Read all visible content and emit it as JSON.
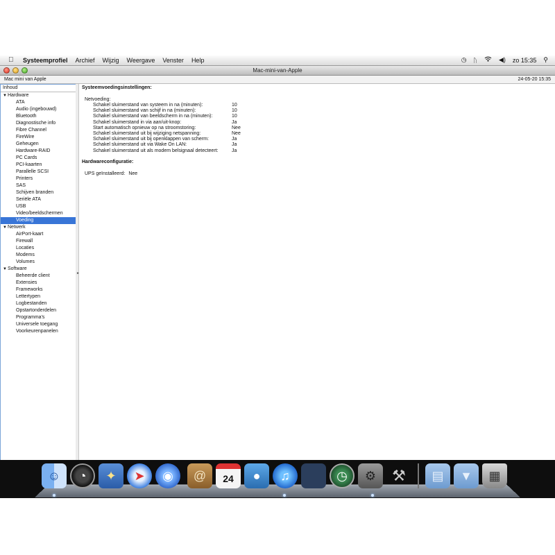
{
  "menubar": {
    "app": "Systeemprofiel",
    "items": [
      "Archief",
      "Wijzig",
      "Weergave",
      "Venster",
      "Help"
    ],
    "clock": "zo 15:35"
  },
  "window": {
    "title": "Mac-mini-van-Apple",
    "machine_label": "Mac mini  van Apple",
    "date": "24-05-20 15:35"
  },
  "sidebar": {
    "header": "Inhoud",
    "categories": [
      {
        "label": "Hardware",
        "items": [
          "ATA",
          "Audio (ingebouwd)",
          "Bluetooth",
          "Diagnostische info",
          "Fibre Channel",
          "FireWire",
          "Geheugen",
          "Hardware-RAID",
          "PC Cards",
          "PCI-kaarten",
          "Parallelle SCSI",
          "Printers",
          "SAS",
          "Schijven branden",
          "Seriële ATA",
          "USB",
          "Video/beeldschermen",
          "Voeding"
        ]
      },
      {
        "label": "Netwerk",
        "items": [
          "AirPort-kaart",
          "Firewall",
          "Locaties",
          "Modems",
          "Volumes"
        ]
      },
      {
        "label": "Software",
        "items": [
          "Beheerde client",
          "Extensies",
          "Frameworks",
          "Lettertypen",
          "Logbestanden",
          "Opstartonderdelen",
          "Programma's",
          "Universele toegang",
          "Voorkeurenpanelen"
        ]
      }
    ],
    "selected": "Voeding"
  },
  "content": {
    "section1": "Systeemvoedingsinstellingen:",
    "sub1": "Netvoeding:",
    "settings": [
      {
        "key": "Schakel sluimerstand van systeem in na (minuten):",
        "value": "10"
      },
      {
        "key": "Schakel sluimerstand van schijf in na (minuten):",
        "value": "10"
      },
      {
        "key": "Schakel sluimerstand van beeldscherm in na (minuten):",
        "value": "10"
      },
      {
        "key": "Schakel sluimerstand in via aan/uit-knop:",
        "value": "Ja"
      },
      {
        "key": "Start automatisch opnieuw op na stroomstoring:",
        "value": "Nee"
      },
      {
        "key": "Schakel sluimerstand uit bij wijziging netspanning:",
        "value": "Nee"
      },
      {
        "key": "Schakel sluimerstand uit bij openklappen van scherm:",
        "value": "Ja"
      },
      {
        "key": "Schakel sluimerstand uit via Wake On LAN:",
        "value": "Ja"
      },
      {
        "key": "Schakel sluimerstand uit als modem belsignaal detecteert:",
        "value": "Ja"
      }
    ],
    "section2": "Hardwareconfiguratie:",
    "ups_label": "UPS geïnstalleerd:",
    "ups_value": "Nee"
  },
  "dock": {
    "calendar_day": "24",
    "icons": [
      "finder-icon",
      "dashboard-icon",
      "mail-icon",
      "safari-icon",
      "ichat-icon",
      "address-book-icon",
      "ical-icon",
      "iphoto-icon",
      "itunes-icon",
      "spaces-icon",
      "time-machine-icon",
      "system-preferences-icon",
      "utilities-icon",
      "documents-folder-icon",
      "downloads-folder-icon",
      "trash-icon"
    ]
  }
}
